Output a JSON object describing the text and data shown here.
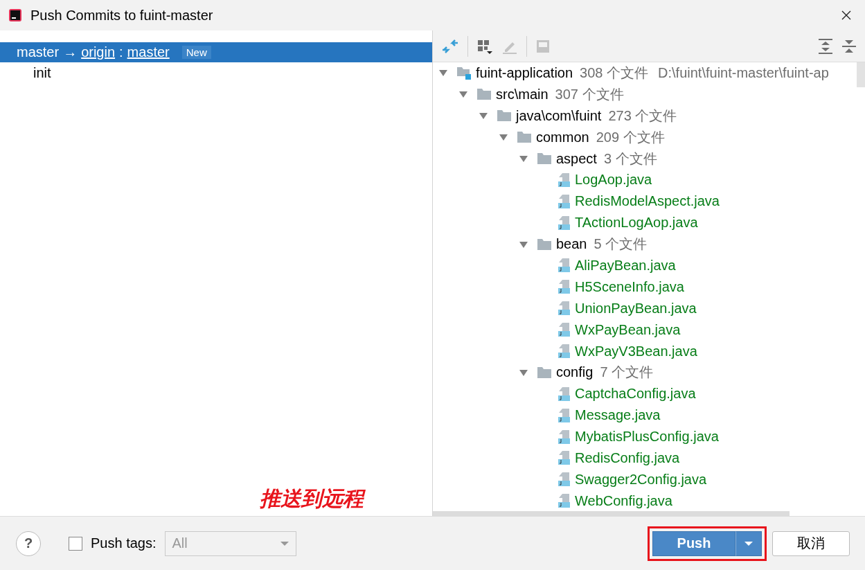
{
  "window": {
    "title": "Push Commits to fuint-master"
  },
  "commits": {
    "branch": {
      "selected": true,
      "local": "master",
      "arrow": "→",
      "remote": "origin",
      "separator": ":",
      "target": "master",
      "badge": "New"
    },
    "items": [
      {
        "label": "init",
        "selected": false
      }
    ]
  },
  "toolbar": {
    "buttons": [
      {
        "kind": "diff",
        "disabled": false
      },
      {
        "kind": "group",
        "disabled": false
      },
      {
        "kind": "edit",
        "disabled": true
      },
      {
        "kind": "preview",
        "disabled": true
      },
      {
        "kind": "expand-all",
        "disabled": false
      },
      {
        "kind": "collapse-all",
        "disabled": false
      }
    ]
  },
  "tree": [
    {
      "kind": "module",
      "name": "fuint-application",
      "count": "308 个文件",
      "path": "D:\\fuint\\fuint-master\\fuint-ap",
      "expanded": true,
      "children": [
        {
          "kind": "folder",
          "name": "src\\main",
          "count": "307 个文件",
          "expanded": true,
          "children": [
            {
              "kind": "folder",
              "name": "java\\com\\fuint",
              "count": "273 个文件",
              "expanded": true,
              "children": [
                {
                  "kind": "folder",
                  "name": "common",
                  "count": "209 个文件",
                  "expanded": true,
                  "children": [
                    {
                      "kind": "folder",
                      "name": "aspect",
                      "count": "3 个文件",
                      "expanded": true,
                      "children": [
                        {
                          "kind": "file",
                          "name": "LogAop.java"
                        },
                        {
                          "kind": "file",
                          "name": "RedisModelAspect.java"
                        },
                        {
                          "kind": "file",
                          "name": "TActionLogAop.java"
                        }
                      ]
                    },
                    {
                      "kind": "folder",
                      "name": "bean",
                      "count": "5 个文件",
                      "expanded": true,
                      "children": [
                        {
                          "kind": "file",
                          "name": "AliPayBean.java"
                        },
                        {
                          "kind": "file",
                          "name": "H5SceneInfo.java"
                        },
                        {
                          "kind": "file",
                          "name": "UnionPayBean.java"
                        },
                        {
                          "kind": "file",
                          "name": "WxPayBean.java"
                        },
                        {
                          "kind": "file",
                          "name": "WxPayV3Bean.java"
                        }
                      ]
                    },
                    {
                      "kind": "folder",
                      "name": "config",
                      "count": "7 个文件",
                      "expanded": true,
                      "children": [
                        {
                          "kind": "file",
                          "name": "CaptchaConfig.java"
                        },
                        {
                          "kind": "file",
                          "name": "Message.java"
                        },
                        {
                          "kind": "file",
                          "name": "MybatisPlusConfig.java"
                        },
                        {
                          "kind": "file",
                          "name": "RedisConfig.java"
                        },
                        {
                          "kind": "file",
                          "name": "Swagger2Config.java"
                        },
                        {
                          "kind": "file",
                          "name": "WebConfig.java"
                        }
                      ]
                    }
                  ]
                }
              ]
            }
          ]
        }
      ]
    }
  ],
  "annotation": "推送到远程",
  "footer": {
    "help": "?",
    "push_tags": {
      "label": "Push tags:",
      "checked": false,
      "value": "All",
      "disabled": true
    },
    "push": {
      "label": "Push",
      "highlighted": true
    },
    "cancel": "取消"
  }
}
